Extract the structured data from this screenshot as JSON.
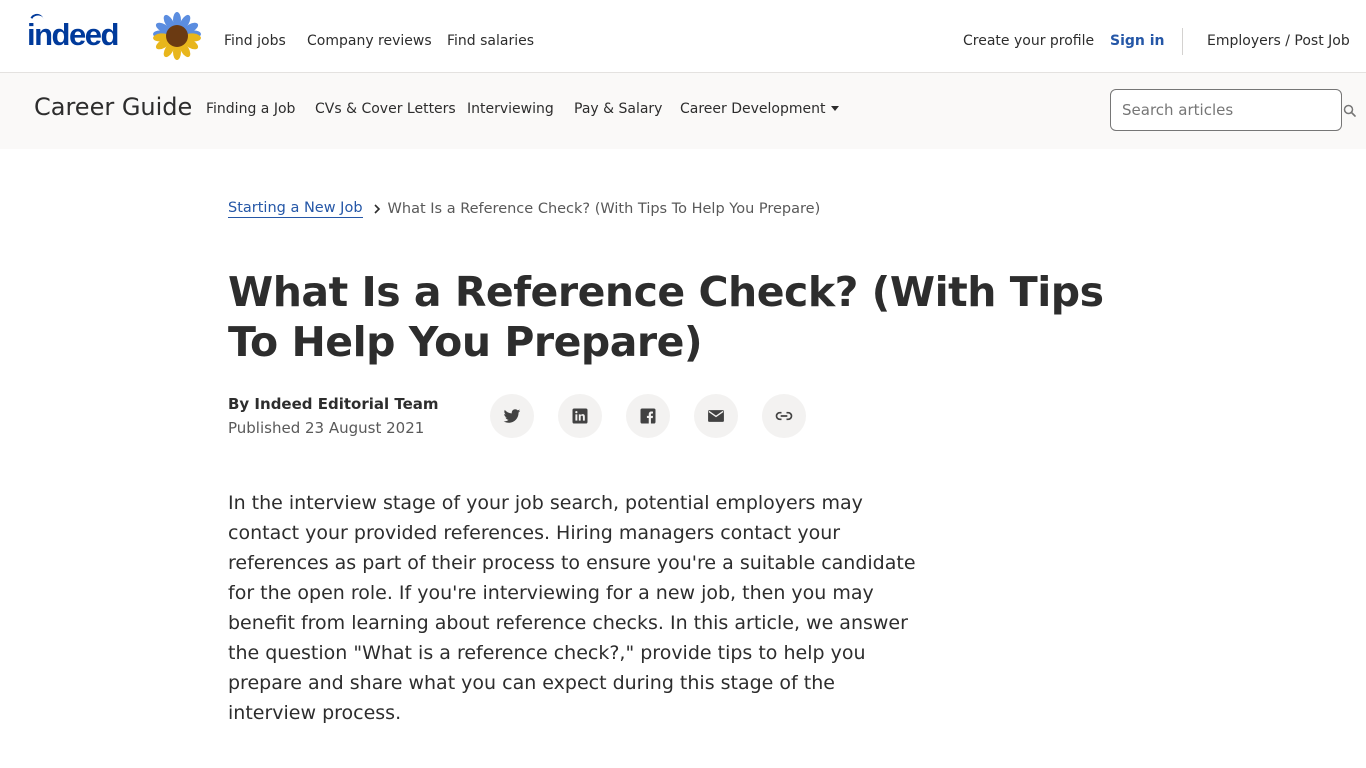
{
  "header": {
    "logo_text": "indeed",
    "nav": {
      "find_jobs": "Find jobs",
      "company_reviews": "Company reviews",
      "find_salaries": "Find salaries",
      "create_profile": "Create your profile",
      "sign_in": "Sign in",
      "employers": "Employers / Post Job"
    },
    "colors": {
      "brand": "#003a9b",
      "link": "#2557a7"
    }
  },
  "subheader": {
    "title": "Career Guide",
    "items": [
      {
        "label": "Finding a Job"
      },
      {
        "label": "CVs & Cover Letters"
      },
      {
        "label": "Interviewing"
      },
      {
        "label": "Pay & Salary"
      },
      {
        "label": "Career Development",
        "has_dropdown": true
      }
    ],
    "search": {
      "placeholder": "Search articles",
      "value": "",
      "icon": "search-icon"
    }
  },
  "breadcrumb": {
    "parent": "Starting a New Job",
    "current": "What Is a Reference Check? (With Tips To Help You Prepare)"
  },
  "article": {
    "title": "What Is a Reference Check? (With Tips To Help You Prepare)",
    "author": "By Indeed Editorial Team",
    "published": "Published 23 August 2021",
    "share_icons": [
      "twitter-icon",
      "linkedin-icon",
      "facebook-icon",
      "email-icon",
      "link-icon"
    ],
    "intro": "In the interview stage of your job search, potential employers may contact your provided references. Hiring managers contact your references as part of their process to ensure you're a suitable candidate for the open role. If you're interviewing for a new job, then you may benefit from learning about reference checks. In this article, we answer the question \"What is a reference check?,\" provide tips to help you prepare and share what you can expect during this stage of the interview process."
  }
}
